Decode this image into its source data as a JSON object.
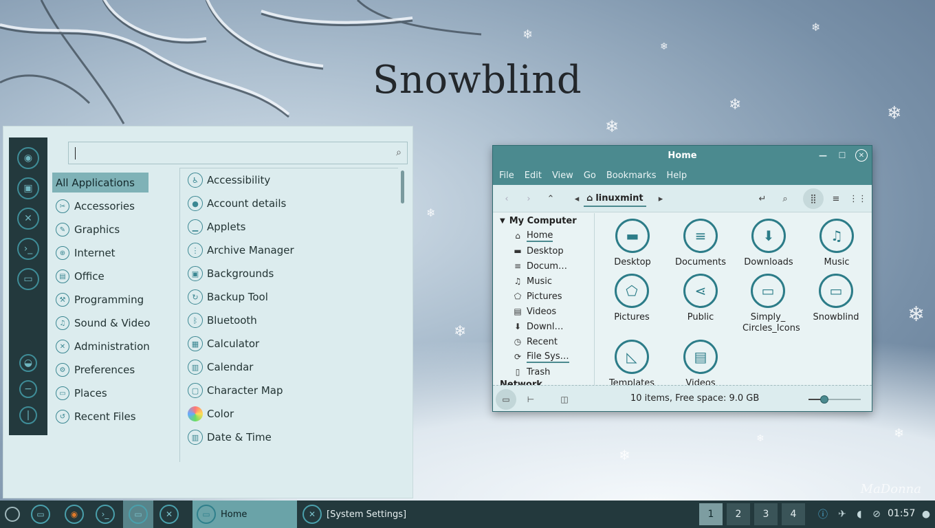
{
  "wallpaper": {
    "title": "Snowblind",
    "signature": "MaDonna"
  },
  "menu": {
    "search": {
      "value": "",
      "placeholder": ""
    },
    "favorites": [
      "firefox-icon",
      "software-manager-icon",
      "settings-icon",
      "terminal-icon",
      "files-icon"
    ],
    "session": [
      "lock-screen-icon",
      "logout-icon",
      "power-icon"
    ],
    "categories": [
      {
        "label": "All Applications",
        "icon": "all-apps-icon"
      },
      {
        "label": "Accessories",
        "icon": "accessories-icon"
      },
      {
        "label": "Graphics",
        "icon": "graphics-icon"
      },
      {
        "label": "Internet",
        "icon": "internet-icon"
      },
      {
        "label": "Office",
        "icon": "office-icon"
      },
      {
        "label": "Programming",
        "icon": "programming-icon"
      },
      {
        "label": "Sound & Video",
        "icon": "sound-video-icon"
      },
      {
        "label": "Administration",
        "icon": "administration-icon"
      },
      {
        "label": "Preferences",
        "icon": "preferences-icon"
      },
      {
        "label": "Places",
        "icon": "places-icon"
      },
      {
        "label": "Recent Files",
        "icon": "recent-files-icon"
      }
    ],
    "apps": [
      {
        "label": "Accessibility",
        "icon": "accessibility-icon"
      },
      {
        "label": "Account details",
        "icon": "account-icon"
      },
      {
        "label": "Applets",
        "icon": "applets-icon"
      },
      {
        "label": "Archive Manager",
        "icon": "archive-icon"
      },
      {
        "label": "Backgrounds",
        "icon": "backgrounds-icon"
      },
      {
        "label": "Backup Tool",
        "icon": "backup-icon"
      },
      {
        "label": "Bluetooth",
        "icon": "bluetooth-icon"
      },
      {
        "label": "Calculator",
        "icon": "calculator-icon"
      },
      {
        "label": "Calendar",
        "icon": "calendar-icon"
      },
      {
        "label": "Character Map",
        "icon": "character-map-icon"
      },
      {
        "label": "Color",
        "icon": "color-icon"
      },
      {
        "label": "Date & Time",
        "icon": "date-time-icon"
      }
    ]
  },
  "filemanager": {
    "title": "Home",
    "menubar": [
      "File",
      "Edit",
      "View",
      "Go",
      "Bookmarks",
      "Help"
    ],
    "breadcrumb": "linuxmint",
    "sidebar": {
      "heading": "My Computer",
      "items": [
        {
          "label": "Home",
          "icon": "home-icon"
        },
        {
          "label": "Desktop",
          "icon": "desktop-icon"
        },
        {
          "label": "Docum…",
          "icon": "documents-icon"
        },
        {
          "label": "Music",
          "icon": "music-icon"
        },
        {
          "label": "Pictures",
          "icon": "pictures-icon"
        },
        {
          "label": "Videos",
          "icon": "videos-icon"
        },
        {
          "label": "Downl…",
          "icon": "downloads-icon"
        },
        {
          "label": "Recent",
          "icon": "recent-icon"
        },
        {
          "label": "File Sys…",
          "icon": "filesystem-icon"
        },
        {
          "label": "Trash",
          "icon": "trash-icon"
        }
      ],
      "next_heading": "Network"
    },
    "files": [
      {
        "label": "Desktop",
        "icon": "desktop-folder-icon"
      },
      {
        "label": "Documents",
        "icon": "documents-folder-icon"
      },
      {
        "label": "Downloads",
        "icon": "downloads-folder-icon"
      },
      {
        "label": "Music",
        "icon": "music-folder-icon"
      },
      {
        "label": "Pictures",
        "icon": "pictures-folder-icon"
      },
      {
        "label": "Public",
        "icon": "public-folder-icon"
      },
      {
        "label": "Simply_ Circles_Icons",
        "icon": "folder-icon"
      },
      {
        "label": "Snowblind",
        "icon": "folder-icon"
      },
      {
        "label": "Templates",
        "icon": "templates-folder-icon"
      },
      {
        "label": "Videos",
        "icon": "videos-folder-icon"
      }
    ],
    "status": "10 items, Free space: 9.0 GB",
    "zoom_level": 0.3
  },
  "panel": {
    "windows": [
      {
        "label": "Home",
        "icon": "files-icon"
      },
      {
        "label": "[System Settings]",
        "icon": "settings-icon"
      }
    ],
    "workspaces": [
      "1",
      "2",
      "3",
      "4"
    ],
    "active_workspace": "1",
    "clock": "01:57"
  }
}
